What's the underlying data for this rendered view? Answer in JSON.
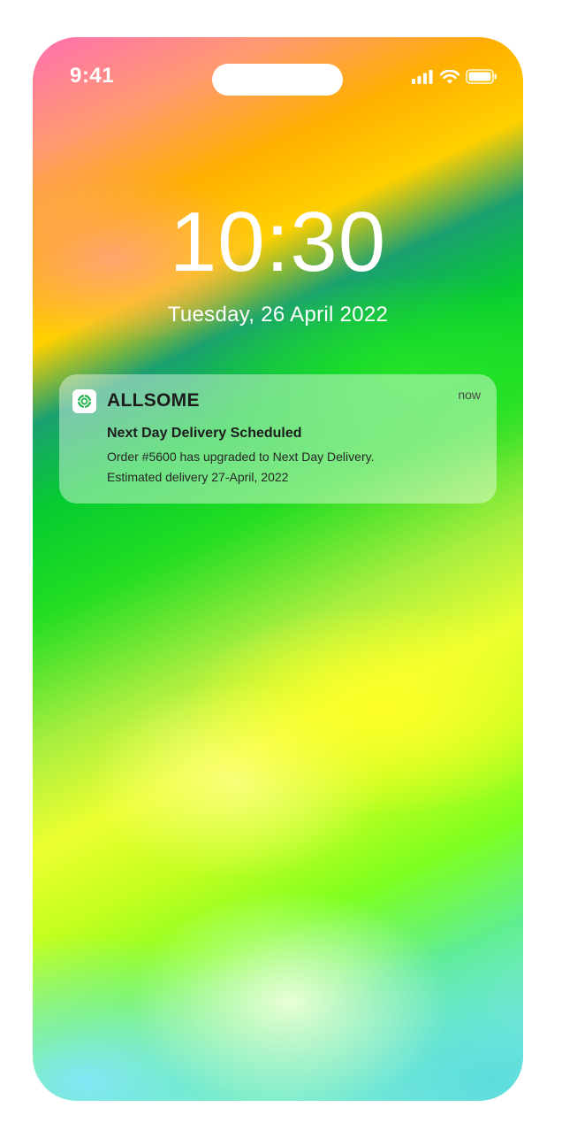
{
  "status_bar": {
    "time": "9:41",
    "icons": [
      "signal-icon",
      "wifi-icon",
      "battery-icon"
    ]
  },
  "lock_screen": {
    "clock": "10:30",
    "date": "Tuesday, 26 April 2022"
  },
  "notification": {
    "app_icon": "allsome-logo-icon",
    "app_name": "ALLSOME",
    "time": "now",
    "title": "Next Day Delivery Scheduled",
    "body_line1": "Order #5600 has upgraded to Next Day Delivery.",
    "body_line2": "Estimated delivery 27-April, 2022"
  },
  "colors": {
    "text_on_wallpaper": "#ffffff",
    "accent_green": "#22b14c"
  }
}
